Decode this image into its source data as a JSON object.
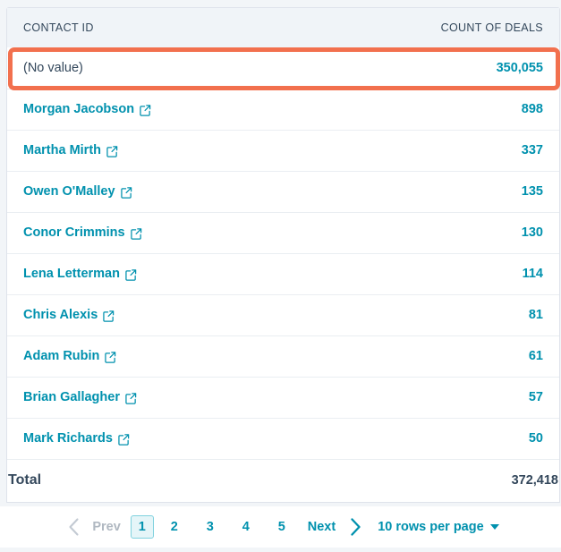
{
  "table": {
    "columns": [
      {
        "key": "contact",
        "label": "CONTACT ID",
        "align": "left"
      },
      {
        "key": "count",
        "label": "COUNT OF DEALS",
        "align": "right"
      }
    ],
    "rows": [
      {
        "contact": "(No value)",
        "count": "350,055",
        "is_link": false,
        "highlighted": true
      },
      {
        "contact": "Morgan Jacobson",
        "count": "898",
        "is_link": true,
        "highlighted": false
      },
      {
        "contact": "Martha Mirth",
        "count": "337",
        "is_link": true,
        "highlighted": false
      },
      {
        "contact": "Owen O'Malley",
        "count": "135",
        "is_link": true,
        "highlighted": false
      },
      {
        "contact": "Conor Crimmins",
        "count": "130",
        "is_link": true,
        "highlighted": false
      },
      {
        "contact": "Lena Letterman",
        "count": "114",
        "is_link": true,
        "highlighted": false
      },
      {
        "contact": "Chris Alexis",
        "count": "81",
        "is_link": true,
        "highlighted": false
      },
      {
        "contact": "Adam Rubin",
        "count": "61",
        "is_link": true,
        "highlighted": false
      },
      {
        "contact": "Brian Gallagher",
        "count": "57",
        "is_link": true,
        "highlighted": false
      },
      {
        "contact": "Mark Richards",
        "count": "50",
        "is_link": true,
        "highlighted": false
      }
    ],
    "total": {
      "label": "Total",
      "count": "372,418"
    },
    "row_link_icon": "external-link-icon"
  },
  "pagination": {
    "prev_chevron_icon": "chevron-left-icon",
    "prev_label": "Prev",
    "pages": [
      "1",
      "2",
      "3",
      "4",
      "5"
    ],
    "active_page": "1",
    "next_label": "Next",
    "next_chevron_icon": "chevron-right-icon",
    "rows_per_page_label": "10 rows per page",
    "rows_per_page_caret_icon": "caret-down-icon"
  },
  "colors": {
    "link": "#0091ae",
    "text_dark": "#33475b",
    "highlight_ring": "#f2704e",
    "header_bg": "#f0f4f8",
    "page_bg": "#f2f5f8",
    "border": "#dfe3eb",
    "active_page_bg": "#e5f5f8",
    "disabled_text": "#b0b8c1"
  }
}
